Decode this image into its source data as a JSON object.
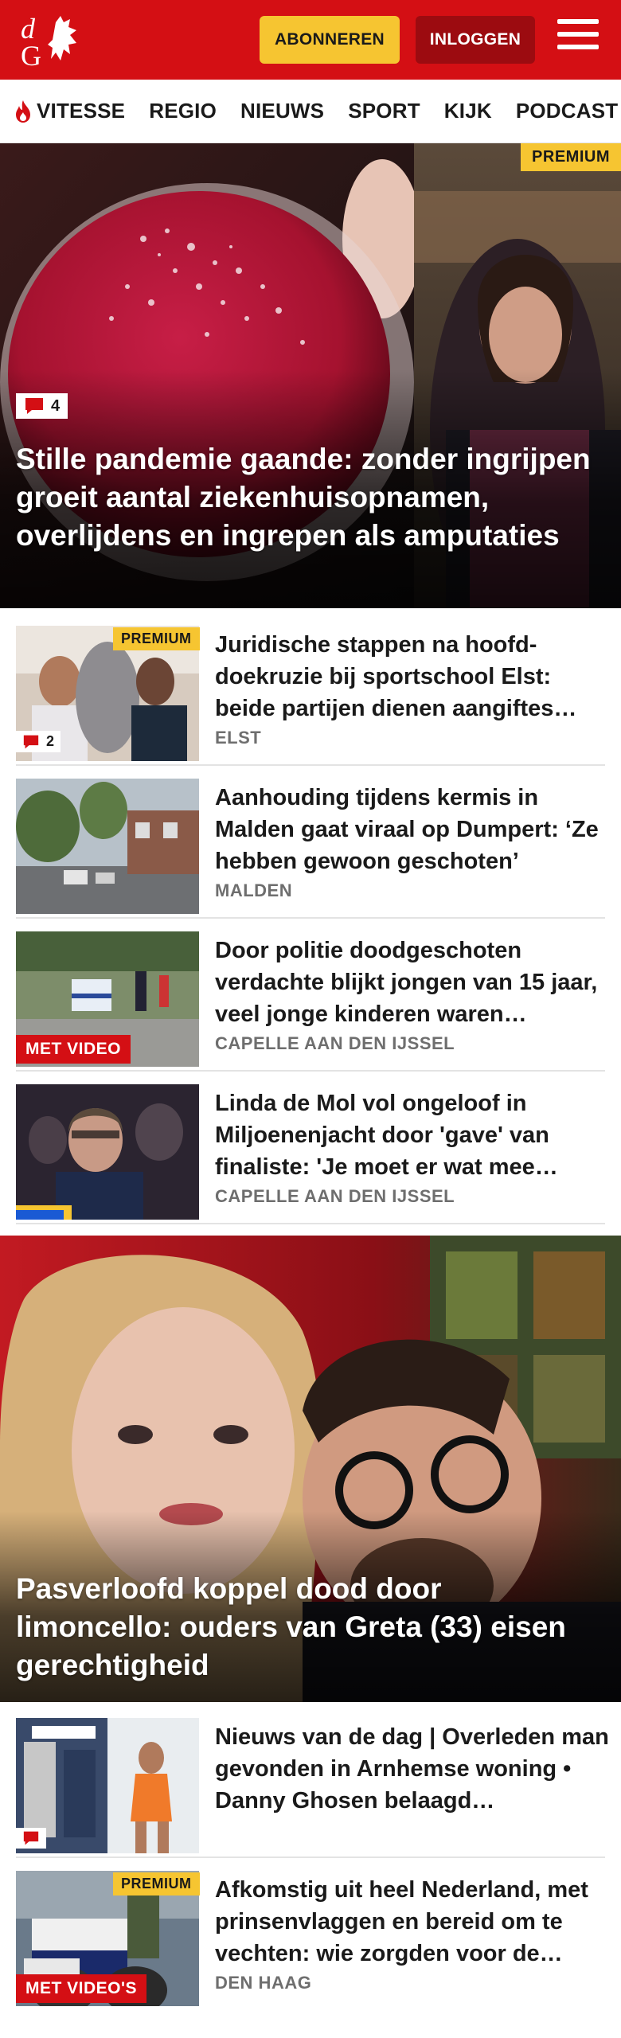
{
  "header": {
    "logo_text": "dG",
    "subscribe_label": "ABONNEREN",
    "login_label": "INLOGGEN",
    "menu_icon": "hamburger-icon"
  },
  "nav": {
    "items": [
      "VITESSE",
      "REGIO",
      "NIEUWS",
      "SPORT",
      "KIJK",
      "PODCAST"
    ]
  },
  "hero": {
    "premium_label": "PREMIUM",
    "comment_count": "4",
    "title": "Stille pandemie gaande: zonder ingrijpen groeit aantal ziekenhuisop­namen, overlijdens en ingrepen als amputaties"
  },
  "articles": [
    {
      "title": "Juridische stappen na hoofd­ doekruzie bij sportschool Elst: beide partijen dienen aangiftes…",
      "meta": "ELST",
      "premium_label": "PREMIUM",
      "comment_count": "2"
    },
    {
      "title": "Aanhouding tijdens kermis in Malden gaat viraal op Dumpert: ‘Ze hebben gewoon geschoten’",
      "meta": "MALDEN"
    },
    {
      "title": "Door politie doodgeschoten verdachte blijkt jongen van 15 jaar, veel jonge kinderen waren…",
      "meta": "CAPELLE AAN DEN IJSSEL",
      "video_label": "MET VIDEO"
    },
    {
      "title": "Linda de Mol vol ongeloof in Miljoenenjacht door 'gave' van finaliste: 'Je moet er wat mee…",
      "meta": "CAPELLE AAN DEN IJSSEL"
    }
  ],
  "hero2": {
    "title": "Pasverloofd koppel dood door limoncello: ouders van Greta (33) eisen gerechtigheid"
  },
  "articles2": [
    {
      "title": "Nieuws van de dag | Overleden man gevonden in Arnhemse woning • Danny Ghosen belaagd…",
      "meta": ""
    },
    {
      "title": "Afkomstig uit heel Nederland, met prinsenvlaggen en bereid om te vechten: wie zorgden voor de…",
      "meta": "DEN HAAG",
      "premium_label": "PREMIUM",
      "video_label": "MET VIDEO'S"
    }
  ],
  "colors": {
    "brand_red": "#d40f14",
    "premium_yellow": "#f6c531",
    "login_dark_red": "#9c0b10"
  }
}
